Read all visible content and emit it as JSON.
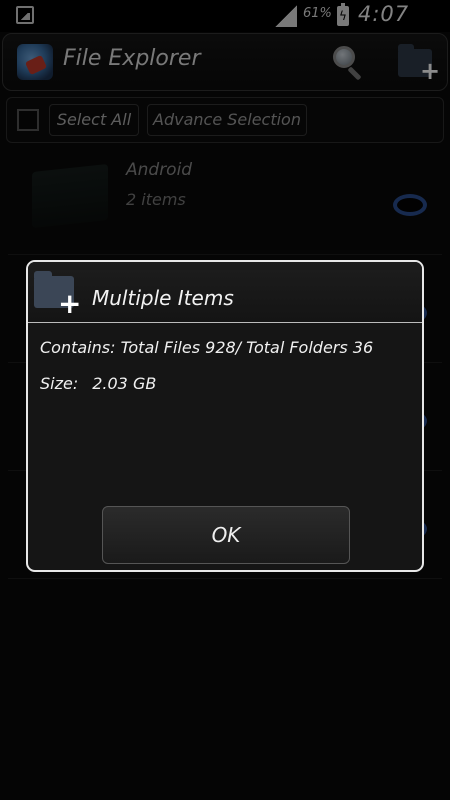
{
  "status_bar": {
    "battery_percent": "61%",
    "time": "4:07 pm",
    "icons": [
      "notification-image-icon",
      "signal-icon",
      "battery-charging-icon"
    ]
  },
  "app_bar": {
    "title": "File Explorer",
    "icons": [
      "app-logo-icon",
      "search-icon",
      "new-folder-icon"
    ]
  },
  "selection_bar": {
    "select_all_label": "Select All",
    "advance_selection_label": "Advance Selection"
  },
  "list": {
    "items": [
      {
        "name": "Android",
        "count": "2 items"
      }
    ]
  },
  "dialog": {
    "title": "Multiple Items",
    "contains_line": "Contains: Total Files 928/ Total Folders 36",
    "size_label": "Size:",
    "size_value": "2.03 GB",
    "ok_label": "OK"
  },
  "colors": {
    "background": "#0a0a0a",
    "radio_accent": "#2a4d8e",
    "dialog_border": "#e8e8e8"
  }
}
